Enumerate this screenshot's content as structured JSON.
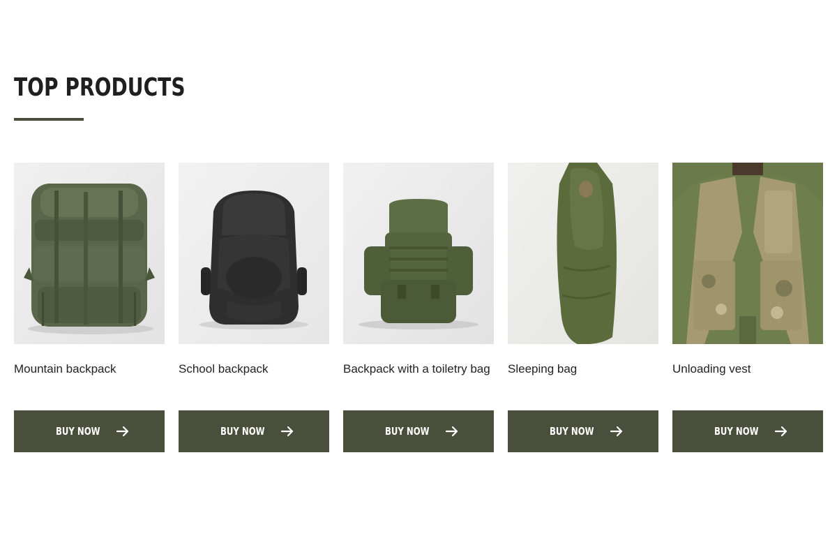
{
  "section": {
    "title": "TOP PRODUCTS"
  },
  "products": [
    {
      "name": "Mountain backpack",
      "button": "BUY NOW",
      "image": "mountain-backpack-photo"
    },
    {
      "name": "School backpack",
      "button": "BUY NOW",
      "image": "school-backpack-photo"
    },
    {
      "name": "Backpack with a toiletry bag",
      "button": "BUY NOW",
      "image": "toiletry-backpack-photo"
    },
    {
      "name": "Sleeping bag",
      "button": "BUY NOW",
      "image": "sleeping-bag-photo"
    },
    {
      "name": "Unloading vest",
      "button": "BUY NOW",
      "image": "unloading-vest-photo"
    }
  ],
  "colors": {
    "accent": "#4a4f3b",
    "button_text": "#ffffff",
    "heading": "#1f1f1f"
  },
  "icons": {
    "button_icon": "arrow-right-icon"
  }
}
